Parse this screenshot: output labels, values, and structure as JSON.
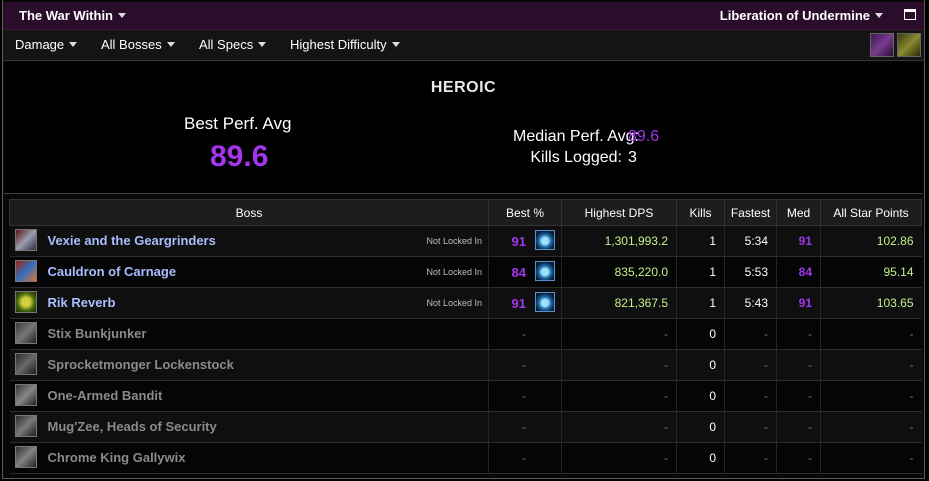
{
  "topbar": {
    "expansion": "The War Within",
    "raid": "Liberation of Undermine"
  },
  "filters": {
    "metric": "Damage",
    "bosses": "All Bosses",
    "specs": "All Specs",
    "difficulty": "Highest Difficulty"
  },
  "summary": {
    "difficulty": "HEROIC",
    "best_perf_label": "Best Perf. Avg",
    "best_perf_value": "89.6",
    "median_label": "Median Perf. Avg:",
    "median_value": "89.6",
    "kills_label": "Kills Logged:",
    "kills_value": "3"
  },
  "table": {
    "headers": [
      "Boss",
      "Best %",
      "Highest DPS",
      "Kills",
      "Fastest",
      "Med",
      "All Star Points"
    ],
    "rows": [
      {
        "boss": "Vexie and the Geargrinders",
        "status": "Not Locked In",
        "best": "91",
        "dps": "1,301,993.2",
        "kills": "1",
        "fastest": "5:34",
        "med": "91",
        "points": "102.86"
      },
      {
        "boss": "Cauldron of Carnage",
        "status": "Not Locked In",
        "best": "84",
        "dps": "835,220.0",
        "kills": "1",
        "fastest": "5:53",
        "med": "84",
        "points": "95.14"
      },
      {
        "boss": "Rik Reverb",
        "status": "Not Locked In",
        "best": "91",
        "dps": "821,367.5",
        "kills": "1",
        "fastest": "5:43",
        "med": "91",
        "points": "103.65"
      },
      {
        "boss": "Stix Bunkjunker",
        "best": "-",
        "dps": "-",
        "kills": "0",
        "fastest": "-",
        "med": "-",
        "points": "-"
      },
      {
        "boss": "Sprocketmonger Lockenstock",
        "best": "-",
        "dps": "-",
        "kills": "0",
        "fastest": "-",
        "med": "-",
        "points": "-"
      },
      {
        "boss": "One-Armed Bandit",
        "best": "-",
        "dps": "-",
        "kills": "0",
        "fastest": "-",
        "med": "-",
        "points": "-"
      },
      {
        "boss": "Mug'Zee, Heads of Security",
        "best": "-",
        "dps": "-",
        "kills": "0",
        "fastest": "-",
        "med": "-",
        "points": "-"
      },
      {
        "boss": "Chrome King Gallywix",
        "best": "-",
        "dps": "-",
        "kills": "0",
        "fastest": "-",
        "med": "-",
        "points": "-"
      }
    ]
  },
  "colors": {
    "accent_purple": "#a335ee",
    "dps_green": "#c6f08a",
    "boss_link": "#a8bfff",
    "topbar_bg": "#2a0d2b"
  },
  "icons": {
    "spec": "frost-spec-icon",
    "filter_1": "raid-buff-icon",
    "filter_2": "key-icon"
  }
}
